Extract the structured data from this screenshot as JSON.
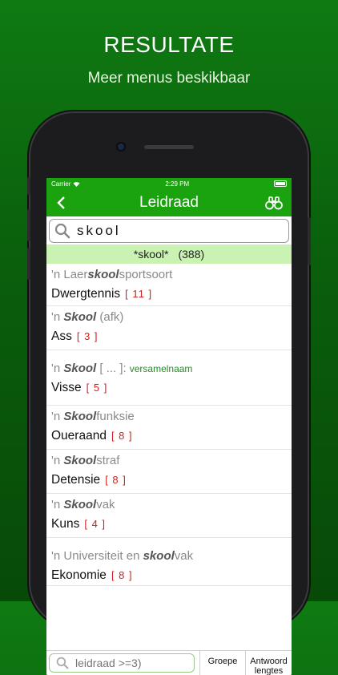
{
  "promo": {
    "title": "RESULTATE",
    "subtitle": "Meer menus beskikbaar"
  },
  "status_bar": {
    "carrier": "Carrier",
    "time": "2:29 PM"
  },
  "nav": {
    "title": "Leidraad",
    "back_icon": "chevron-left-icon",
    "action_icon": "binoculars-icon"
  },
  "search": {
    "value": "skool"
  },
  "result_summary": {
    "query": "*skool*",
    "count": "(388)"
  },
  "results": [
    {
      "pre": "'n Laer",
      "highlight": "skool",
      "post": "sportsoort",
      "note": "",
      "answer": "Dwergtennis",
      "length": "[ 11 ]"
    },
    {
      "pre": "'n ",
      "highlight": "Skool",
      "post": " (afk)",
      "note": "",
      "answer": "Ass",
      "length": "[ 3 ]"
    },
    {
      "pre": "'n ",
      "highlight": "Skool",
      "post": " [ ... ]:",
      "note": "versamelnaam",
      "answer": "Visse",
      "length": "[ 5 ]"
    },
    {
      "pre": "'n ",
      "highlight": "Skool",
      "post": "funksie",
      "note": "",
      "answer": "Oueraand",
      "length": "[ 8 ]"
    },
    {
      "pre": "'n ",
      "highlight": "Skool",
      "post": "straf",
      "note": "",
      "answer": "Detensie",
      "length": "[ 8 ]"
    },
    {
      "pre": "'n ",
      "highlight": "Skool",
      "post": "vak",
      "note": "",
      "answer": "Kuns",
      "length": "[ 4 ]"
    },
    {
      "pre": "'n Universiteit en ",
      "highlight": "skool",
      "post": "vak",
      "note": "",
      "answer": "Ekonomie",
      "length": "[ 8 ]"
    }
  ],
  "bottom": {
    "search_placeholder": "leidraad >=3)",
    "group_label": "Groepe",
    "answer_lengths_label": "Antwoord lengtes"
  },
  "colors": {
    "nav_green": "#1aa30f",
    "summary_green": "#c9f2b3",
    "length_red": "#d02020"
  }
}
